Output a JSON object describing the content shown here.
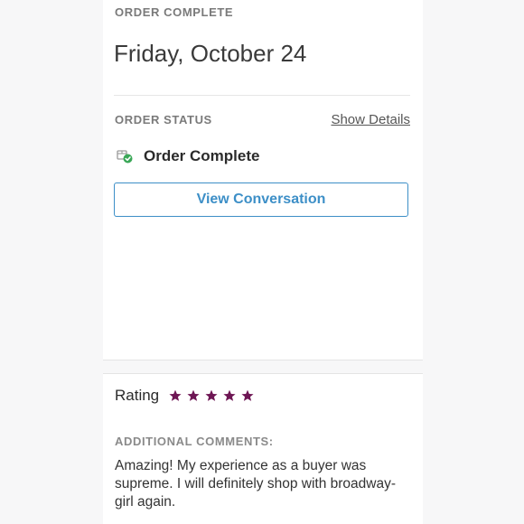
{
  "order": {
    "eyebrow": "ORDER COMPLETE",
    "date": "Friday, October 24"
  },
  "status": {
    "label": "ORDER STATUS",
    "show_details": "Show Details",
    "text": "Order Complete",
    "icon": "package-check-icon"
  },
  "actions": {
    "view_conversation": "View Conversation"
  },
  "rating": {
    "label": "Rating",
    "stars": 5,
    "star_color": "#6e1654"
  },
  "comments": {
    "label": "ADDITIONAL COMMENTS:",
    "text": "Amazing! My experience as a buyer was supreme. I will definitely shop with broadway-girl again."
  },
  "colors": {
    "accent": "#3d8fc7",
    "success": "#3aa757",
    "star": "#6e1654"
  }
}
